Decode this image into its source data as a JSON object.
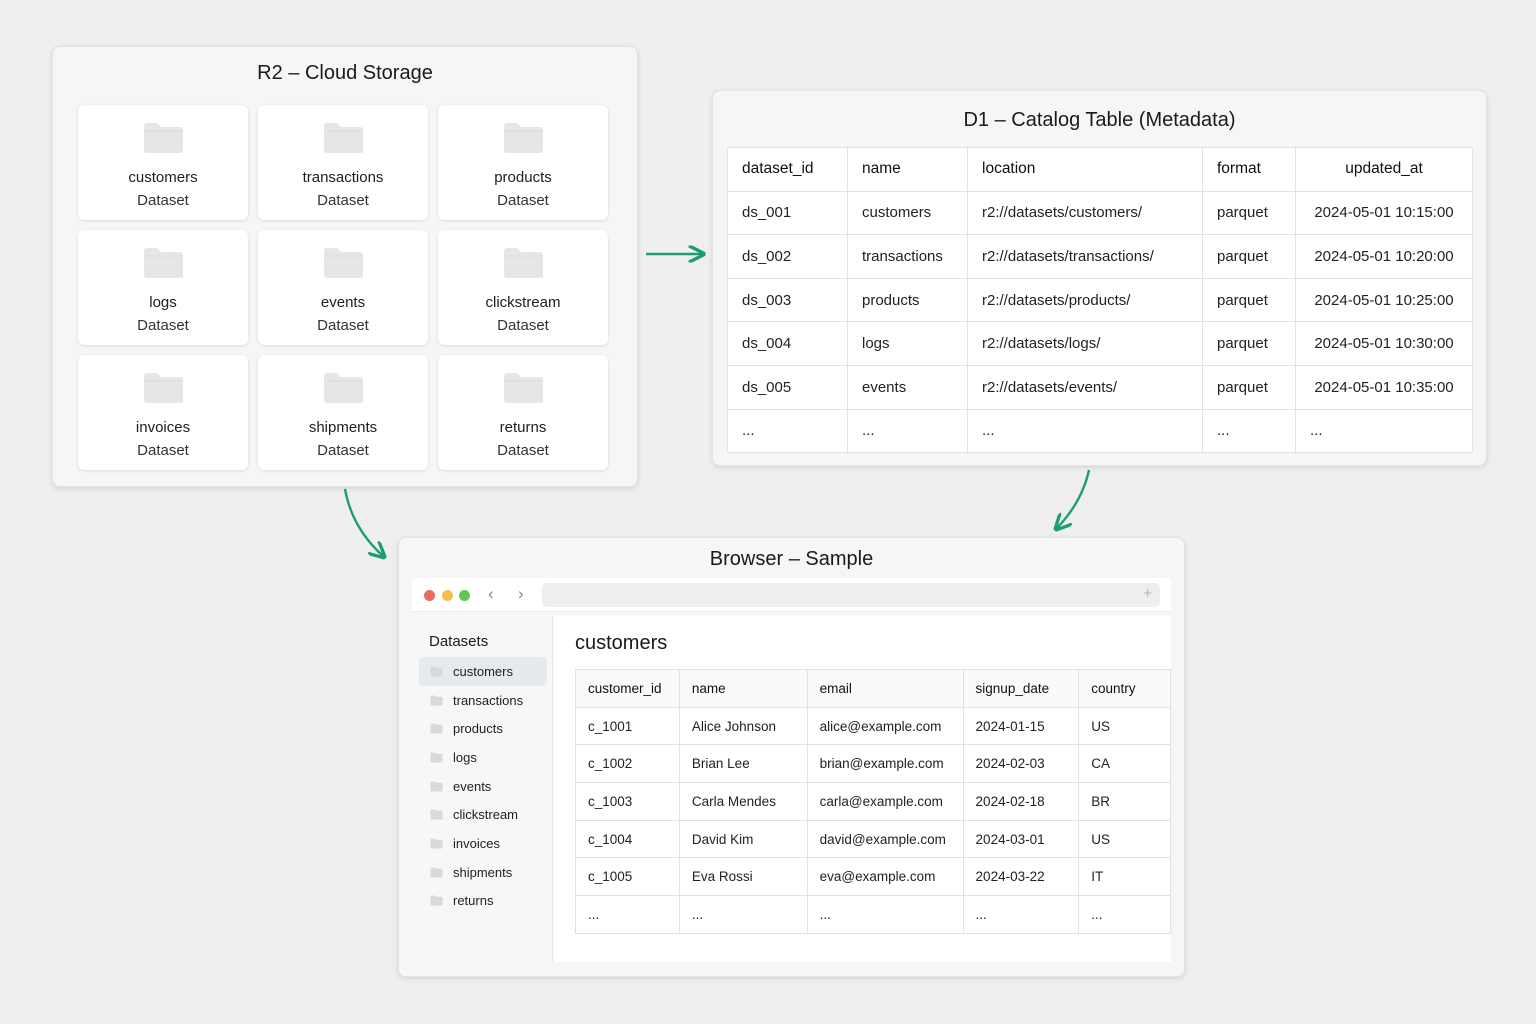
{
  "colors": {
    "arrow": "#1e9e6e",
    "folder": "#e6e6e6",
    "background": "#efefef"
  },
  "r2": {
    "title": "R2 – Cloud Storage",
    "tiles": [
      {
        "name": "customers",
        "type": "Dataset"
      },
      {
        "name": "transactions",
        "type": "Dataset"
      },
      {
        "name": "products",
        "type": "Dataset"
      },
      {
        "name": "logs",
        "type": "Dataset"
      },
      {
        "name": "events",
        "type": "Dataset"
      },
      {
        "name": "clickstream",
        "type": "Dataset"
      },
      {
        "name": "invoices",
        "type": "Dataset"
      },
      {
        "name": "shipments",
        "type": "Dataset"
      },
      {
        "name": "returns",
        "type": "Dataset"
      }
    ]
  },
  "d1": {
    "title": "D1 – Catalog Table (Metadata)",
    "columns": [
      "dataset_id",
      "name",
      "location",
      "format",
      "updated_at"
    ],
    "rows": [
      [
        "ds_001",
        "customers",
        "r2://datasets/customers/",
        "parquet",
        "2024-05-01 10:15:00"
      ],
      [
        "ds_002",
        "transactions",
        "r2://datasets/transactions/",
        "parquet",
        "2024-05-01 10:20:00"
      ],
      [
        "ds_003",
        "products",
        "r2://datasets/products/",
        "parquet",
        "2024-05-01 10:25:00"
      ],
      [
        "ds_004",
        "logs",
        "r2://datasets/logs/",
        "parquet",
        "2024-05-01 10:30:00"
      ],
      [
        "ds_005",
        "events",
        "r2://datasets/events/",
        "parquet",
        "2024-05-01 10:35:00"
      ],
      [
        "...",
        "...",
        "...",
        "...",
        "..."
      ]
    ]
  },
  "browser": {
    "title": "Browser – Sample",
    "sidebar": {
      "heading": "Datasets",
      "items": [
        "customers",
        "transactions",
        "products",
        "logs",
        "events",
        "clickstream",
        "invoices",
        "shipments",
        "returns"
      ],
      "active_index": 0
    },
    "content": {
      "title": "customers",
      "columns": [
        "customer_id",
        "name",
        "email",
        "signup_date",
        "country"
      ],
      "rows": [
        [
          "c_1001",
          "Alice Johnson",
          "alice@example.com",
          "2024-01-15",
          "US"
        ],
        [
          "c_1002",
          "Brian Lee",
          "brian@example.com",
          "2024-02-03",
          "CA"
        ],
        [
          "c_1003",
          "Carla Mendes",
          "carla@example.com",
          "2024-02-18",
          "BR"
        ],
        [
          "c_1004",
          "David Kim",
          "david@example.com",
          "2024-03-01",
          "US"
        ],
        [
          "c_1005",
          "Eva Rossi",
          "eva@example.com",
          "2024-03-22",
          "IT"
        ],
        [
          "...",
          "...",
          "...",
          "...",
          "..."
        ]
      ]
    },
    "nav": {
      "back_icon": "chevron-left-icon",
      "forward_icon": "chevron-right-icon",
      "new_tab_icon": "plus-icon"
    }
  }
}
